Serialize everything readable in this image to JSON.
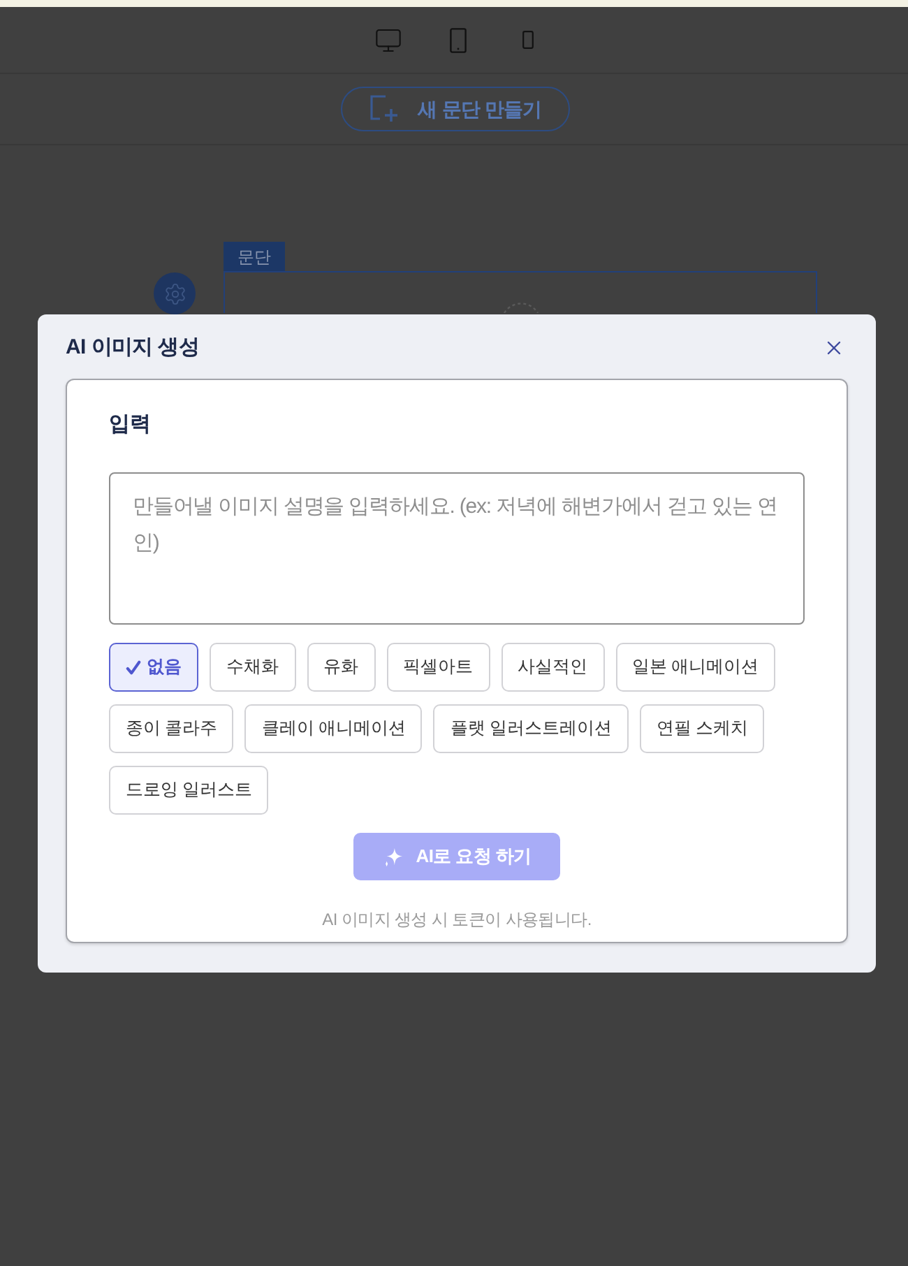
{
  "new_paragraph_button": {
    "label": "새 문단 만들기"
  },
  "paragraph_block": {
    "tag": "문단"
  },
  "dialog": {
    "title": "AI 이미지 생성",
    "section_title": "입력",
    "prompt": {
      "placeholder": "만들어낼 이미지 설명을 입력하세요. (ex: 저녁에 해변가에서 걷고 있는 연인)"
    },
    "styles": [
      {
        "label": "없음",
        "selected": true
      },
      {
        "label": "수채화",
        "selected": false
      },
      {
        "label": "유화",
        "selected": false
      },
      {
        "label": "픽셀아트",
        "selected": false
      },
      {
        "label": "사실적인",
        "selected": false
      },
      {
        "label": "일본 애니메이션",
        "selected": false
      },
      {
        "label": "종이 콜라주",
        "selected": false
      },
      {
        "label": "클레이 애니메이션",
        "selected": false
      },
      {
        "label": "플랫 일러스트레이션",
        "selected": false
      },
      {
        "label": "연필 스케치",
        "selected": false
      },
      {
        "label": "드로잉 일러스트",
        "selected": false
      }
    ],
    "submit_button": {
      "label": "AI로 요청 하기",
      "disabled": true
    },
    "note": "AI 이미지 생성 시 토큰이 사용됩니다."
  }
}
